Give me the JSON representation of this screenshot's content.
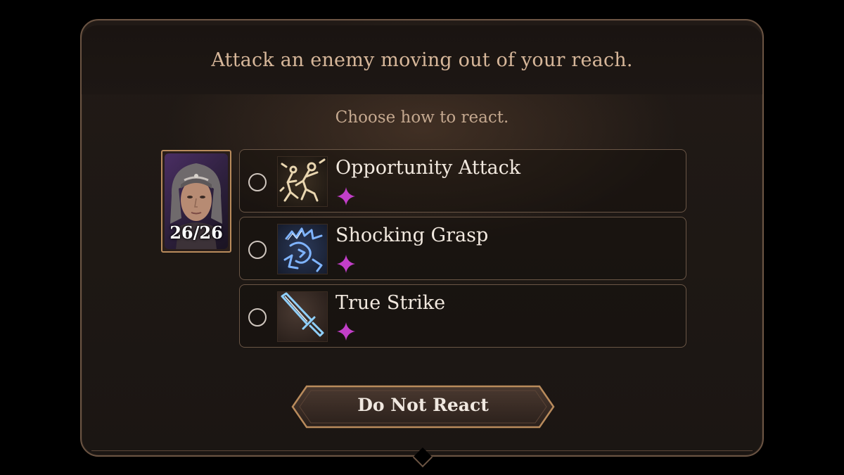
{
  "dialog": {
    "prompt": "Attack an enemy moving out of your reach.",
    "subprompt": "Choose how to react."
  },
  "character": {
    "hp": "26/26"
  },
  "options": [
    {
      "name": "Opportunity Attack",
      "icon": "opportunity-attack-icon",
      "cost_icon": "action-star-icon",
      "cost_color": "#c23fc9"
    },
    {
      "name": "Shocking Grasp",
      "icon": "shocking-grasp-icon",
      "cost_icon": "action-star-icon",
      "cost_color": "#c23fc9"
    },
    {
      "name": "True Strike",
      "icon": "true-strike-icon",
      "cost_icon": "action-star-icon",
      "cost_color": "#c23fc9"
    }
  ],
  "button": {
    "label": "Do Not React"
  }
}
